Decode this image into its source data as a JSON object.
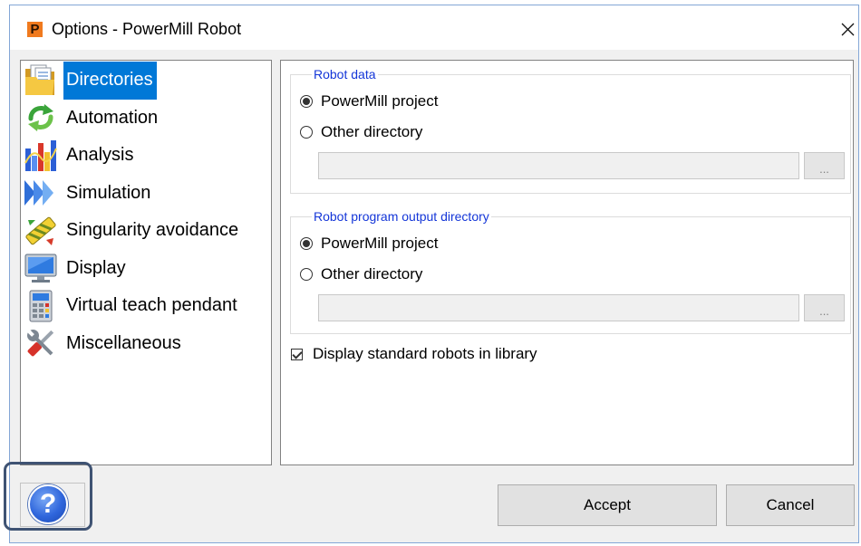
{
  "window": {
    "title": "Options - PowerMill Robot",
    "app_icon_letter": "P"
  },
  "sidebar": {
    "items": [
      {
        "label": "Directories",
        "icon": "folder-icon",
        "selected": true
      },
      {
        "label": "Automation",
        "icon": "automation-icon",
        "selected": false
      },
      {
        "label": "Analysis",
        "icon": "analysis-icon",
        "selected": false
      },
      {
        "label": "Simulation",
        "icon": "simulation-icon",
        "selected": false
      },
      {
        "label": "Singularity avoidance",
        "icon": "singularity-icon",
        "selected": false
      },
      {
        "label": "Display",
        "icon": "display-icon",
        "selected": false
      },
      {
        "label": "Virtual teach pendant",
        "icon": "pendant-icon",
        "selected": false
      },
      {
        "label": "Miscellaneous",
        "icon": "tools-icon",
        "selected": false
      }
    ]
  },
  "robot_data": {
    "legend": "Robot data",
    "options": [
      {
        "label": "PowerMill project",
        "checked": true
      },
      {
        "label": "Other directory",
        "checked": false
      }
    ],
    "browse_label": "..."
  },
  "output_directory": {
    "legend": "Robot program output directory",
    "options": [
      {
        "label": "PowerMill project",
        "checked": true
      },
      {
        "label": "Other directory",
        "checked": false
      }
    ],
    "browse_label": "..."
  },
  "library_option": {
    "label": "Display standard robots in library",
    "checked": true
  },
  "footer": {
    "help_label": "?",
    "accept_label": "Accept",
    "cancel_label": "Cancel"
  },
  "colors": {
    "selection": "#0078d7",
    "legend": "#1436d8",
    "help": "#2f66dc",
    "annotation": "#3f5373",
    "app_icon": "#f07a1e"
  }
}
